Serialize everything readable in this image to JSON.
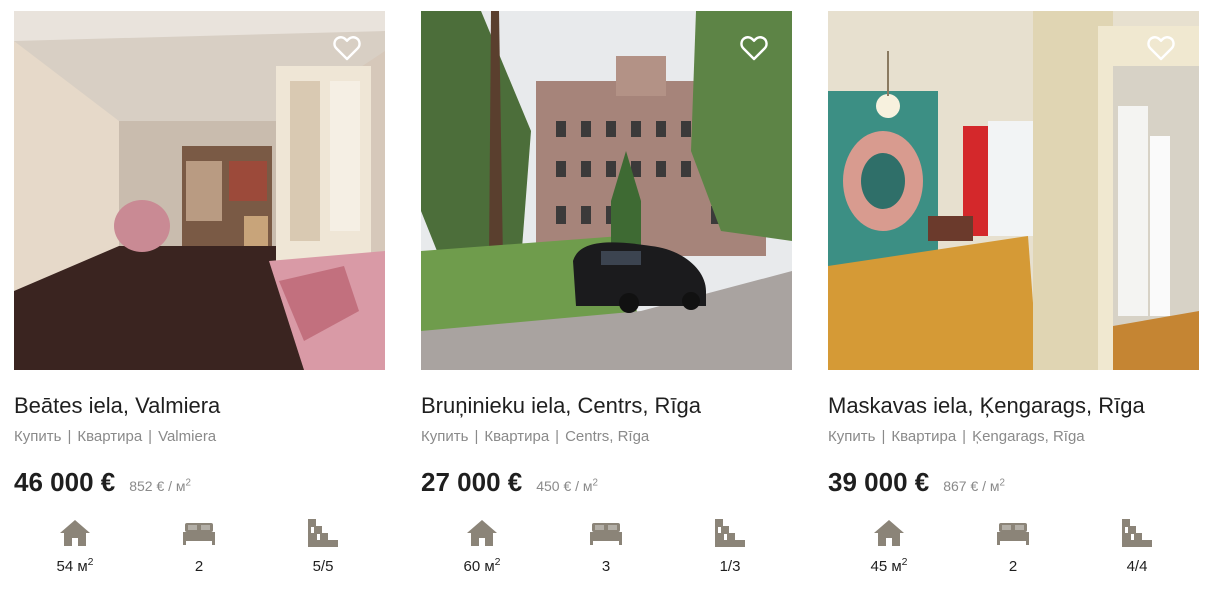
{
  "colors": {
    "icon": "#8b8478",
    "text": "#1f1f1f",
    "muted": "#8a8a8a"
  },
  "listings": [
    {
      "title": "Beātes iela, Valmiera",
      "deal": "Купить",
      "type": "Квартира",
      "location": "Valmiera",
      "price": "46 000 €",
      "price_per_m2": "852 € / м",
      "area": "54 м",
      "rooms": "2",
      "floor": "5/5",
      "favorite_icon": "heart-outline-icon"
    },
    {
      "title": "Bruņinieku iela, Centrs, Rīga",
      "deal": "Купить",
      "type": "Квартира",
      "location": "Centrs, Rīga",
      "price": "27 000 €",
      "price_per_m2": "450 € / м",
      "area": "60 м",
      "rooms": "3",
      "floor": "1/3",
      "favorite_icon": "heart-outline-icon"
    },
    {
      "title": "Maskavas iela, Ķengarags, Rīga",
      "deal": "Купить",
      "type": "Квартира",
      "location": "Ķengarags, Rīga",
      "price": "39 000 €",
      "price_per_m2": "867 € / м",
      "area": "45 м",
      "rooms": "2",
      "floor": "4/4",
      "favorite_icon": "heart-outline-icon"
    }
  ],
  "unit_superscript": "2",
  "feature_icons": [
    "house-icon",
    "bed-icon",
    "stairs-icon"
  ]
}
